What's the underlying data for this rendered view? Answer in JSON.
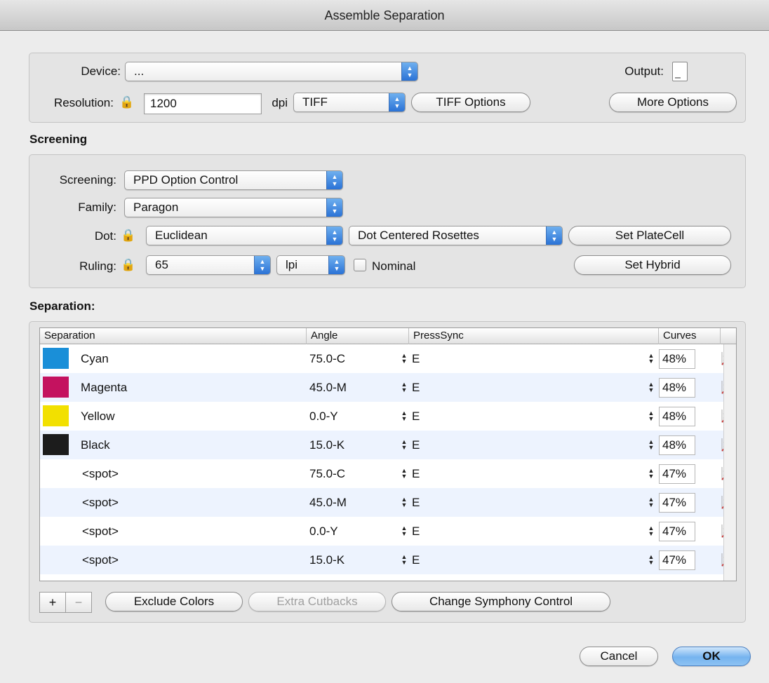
{
  "window": {
    "title": "Assemble Separation"
  },
  "output_group": {
    "device_label": "Device:",
    "device_value": "...",
    "output_label": "Output:",
    "resolution_label": "Resolution:",
    "resolution_value": "1200",
    "resolution_unit": "dpi",
    "format_value": "TIFF",
    "tiff_options_label": "TIFF Options",
    "more_options_label": "More Options",
    "lock_icon": "lock-icon"
  },
  "screening_group": {
    "section_title": "Screening",
    "screening_label": "Screening:",
    "screening_value": "PPD Option Control",
    "family_label": "Family:",
    "family_value": "Paragon",
    "dot_label": "Dot:",
    "dot_value": "Euclidean",
    "dot_arrangement_value": "Dot Centered Rosettes",
    "set_platecell_label": "Set PlateCell",
    "ruling_label": "Ruling:",
    "ruling_value": "65",
    "ruling_unit_value": "lpi",
    "nominal_label": "Nominal",
    "nominal_checked": false,
    "set_hybrid_label": "Set Hybrid"
  },
  "separation_group": {
    "section_title": "Separation:",
    "columns": [
      "Separation",
      "Angle",
      "PressSync",
      "Curves"
    ],
    "rows": [
      {
        "name": "Cyan",
        "swatch": "#1a8fd8",
        "angle": "75.0-C",
        "presssync": "E",
        "percent": "48%"
      },
      {
        "name": "Magenta",
        "swatch": "#c4125f",
        "angle": "45.0-M",
        "presssync": "E",
        "percent": "48%"
      },
      {
        "name": "Yellow",
        "swatch": "#f2e000",
        "angle": "0.0-Y",
        "presssync": "E",
        "percent": "48%"
      },
      {
        "name": "Black",
        "swatch": "#1c1c1c",
        "angle": "15.0-K",
        "presssync": "E",
        "percent": "48%"
      },
      {
        "name": "<spot>",
        "swatch": "",
        "angle": "75.0-C",
        "presssync": "E",
        "percent": "47%"
      },
      {
        "name": "<spot>",
        "swatch": "",
        "angle": "45.0-M",
        "presssync": "E",
        "percent": "47%"
      },
      {
        "name": "<spot>",
        "swatch": "",
        "angle": "0.0-Y",
        "presssync": "E",
        "percent": "47%"
      },
      {
        "name": "<spot>",
        "swatch": "",
        "angle": "15.0-K",
        "presssync": "E",
        "percent": "47%"
      }
    ],
    "add_label": "+",
    "remove_label": "−",
    "exclude_colors_label": "Exclude Colors",
    "extra_cutbacks_label": "Extra Cutbacks",
    "change_symphony_label": "Change Symphony Control"
  },
  "footer": {
    "cancel_label": "Cancel",
    "ok_label": "OK"
  },
  "colors": {
    "accent": "#2a72d6",
    "row_alt": "#edf3fe",
    "curve_icon": "#d23030"
  }
}
